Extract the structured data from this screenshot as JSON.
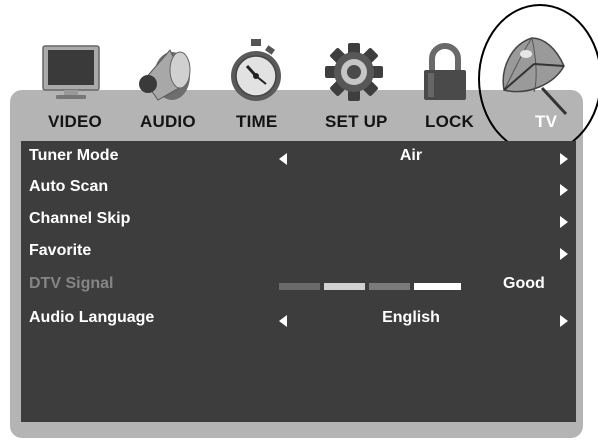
{
  "tabs": [
    {
      "id": "video",
      "label": "VIDEO",
      "icon": "monitor-icon"
    },
    {
      "id": "audio",
      "label": "AUDIO",
      "icon": "speaker-icon"
    },
    {
      "id": "time",
      "label": "TIME",
      "icon": "stopwatch-icon"
    },
    {
      "id": "setup",
      "label": "SET UP",
      "icon": "gear-icon"
    },
    {
      "id": "lock",
      "label": "LOCK",
      "icon": "padlock-icon"
    },
    {
      "id": "tv",
      "label": "TV",
      "icon": "satellite-dish-icon",
      "selected": true
    }
  ],
  "menu": [
    {
      "label": "Tuner Mode",
      "value": "Air",
      "has_left_arrow": true,
      "has_right_arrow": true
    },
    {
      "label": "Auto Scan",
      "value": "",
      "has_right_arrow": true
    },
    {
      "label": "Channel Skip",
      "value": "",
      "has_right_arrow": true
    },
    {
      "label": "Favorite",
      "value": "",
      "has_right_arrow": true
    },
    {
      "label": "DTV Signal",
      "value": "Good",
      "disabled": true,
      "signal_level": 0.8
    },
    {
      "label": "Audio Language",
      "value": "English",
      "has_left_arrow": true,
      "has_right_arrow": true
    }
  ],
  "colors": {
    "frame": "#b4b4b4",
    "panel": "#3d3d3d",
    "text": "#ffffff",
    "disabled_text": "#858585",
    "selected_tab_text": "#ffffff"
  }
}
